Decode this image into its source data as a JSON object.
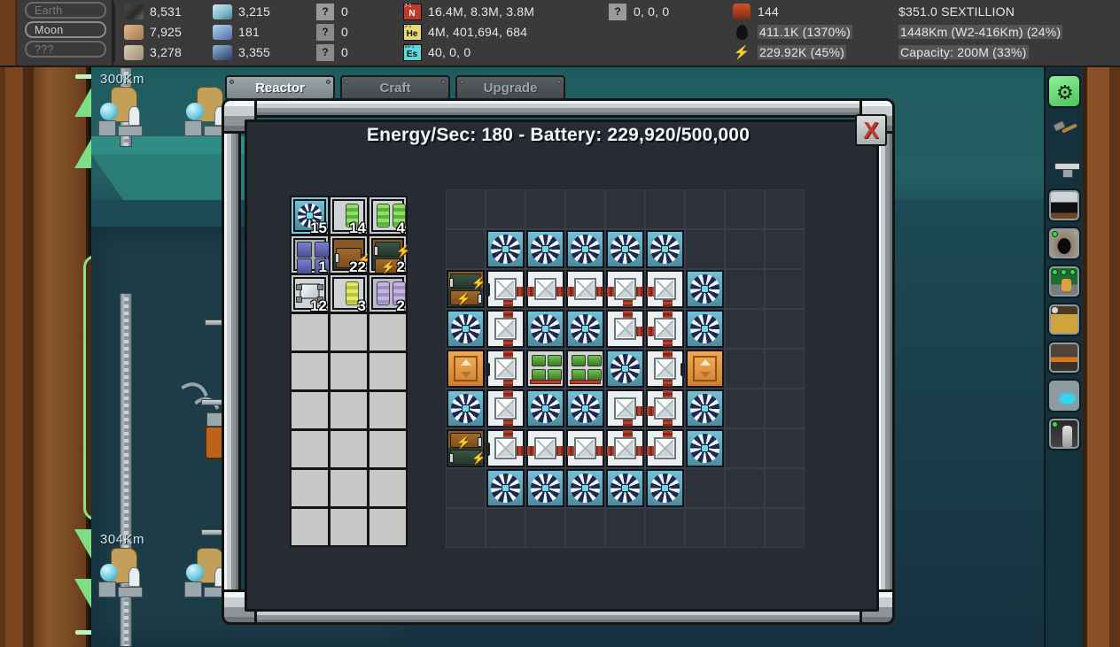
{
  "topbar": {
    "locations": [
      {
        "label": "Earth",
        "state": "dim"
      },
      {
        "label": "Moon",
        "state": "active"
      },
      {
        "label": "???",
        "state": "dim"
      }
    ],
    "ore_column": [
      {
        "icon": "rock-ore-icon",
        "value": "8,531"
      },
      {
        "icon": "sand-ore-icon",
        "value": "7,925"
      },
      {
        "icon": "tan-ore-icon",
        "value": "3,278"
      }
    ],
    "crystal_column": [
      {
        "icon": "crystal-icon",
        "value": "3,215"
      },
      {
        "icon": "ice-block-icon",
        "value": "181"
      },
      {
        "icon": "blue-shard-icon",
        "value": "3,355"
      }
    ],
    "unknown_column": [
      {
        "icon": "question-icon",
        "value": "0"
      },
      {
        "icon": "question-icon",
        "value": "0"
      },
      {
        "icon": "question-icon",
        "value": "0"
      }
    ],
    "element_column": [
      {
        "symbol": "N",
        "sup": "7-1",
        "value": "16.4M, 8.3M, 3.8M"
      },
      {
        "symbol": "He",
        "sup": "2-1",
        "value": "4M, 401,694, 684"
      },
      {
        "symbol": "Es",
        "sup": "99-1",
        "value": "40, 0, 0"
      }
    ],
    "unknown2_column": [
      {
        "icon": "question-icon",
        "value": "0, 0, 0"
      }
    ],
    "production_column": [
      {
        "icon": "miner-icon",
        "value": "144",
        "highlight": false
      },
      {
        "icon": "oil-icon",
        "value": "411.1K (1370%)",
        "highlight": true
      },
      {
        "icon": "power-icon",
        "value": "229.92K (45%)",
        "highlight": true
      }
    ],
    "money_column": [
      {
        "value": "$351.0 SEXTILLION",
        "highlight": false
      },
      {
        "value": "1448Km (W2-416Km) (24%)",
        "highlight": true
      },
      {
        "value": "Capacity: 200M (33%)",
        "highlight": true
      }
    ]
  },
  "world": {
    "depth_top_label": "300Km",
    "depth_bottom_label": "304Km"
  },
  "rail": {
    "items": [
      {
        "name": "settings-gear-icon",
        "label": "Settings"
      },
      {
        "name": "hammer-icon",
        "label": "Craft Hammer"
      },
      {
        "name": "anvil-icon",
        "label": "Anvil"
      },
      {
        "name": "factory-icon",
        "label": "Factory"
      },
      {
        "name": "cave-icon",
        "label": "Cave"
      },
      {
        "name": "market-icon",
        "label": "Market"
      },
      {
        "name": "quarry-icon",
        "label": "Quarry"
      },
      {
        "name": "lava-icon",
        "label": "Lava Mine"
      },
      {
        "name": "reactor-icon",
        "label": "Reactor"
      },
      {
        "name": "rocket-icon",
        "label": "Rocket"
      }
    ]
  },
  "dialog": {
    "tabs": [
      {
        "label": "Reactor",
        "active": true
      },
      {
        "label": "Craft",
        "active": false
      },
      {
        "label": "Upgrade",
        "active": false
      }
    ],
    "close_label": "X",
    "title": "Energy/Sec: 180 - Battery: 229,920/500,000",
    "stats": {
      "energy_per_sec": 180,
      "battery_current": "229,920",
      "battery_max": "500,000"
    },
    "palette": {
      "columns": 3,
      "rows": 9,
      "cells": [
        {
          "type": "fan",
          "count": "15",
          "selected": true
        },
        {
          "type": "fuel-green",
          "count": "14",
          "selected": false
        },
        {
          "type": "fuel-green-double",
          "count": "4",
          "selected": false
        },
        {
          "type": "battery-quad",
          "count": "1",
          "selected": false
        },
        {
          "type": "capacitor",
          "count": "22",
          "selected": false
        },
        {
          "type": "capacitor-double",
          "count": "2",
          "selected": false
        },
        {
          "type": "filter",
          "count": "12",
          "selected": false
        },
        {
          "type": "fuel-yellow",
          "count": "3",
          "selected": false
        },
        {
          "type": "coolant-double",
          "count": "2",
          "selected": false
        },
        {
          "type": "empty",
          "count": "",
          "selected": false
        },
        {
          "type": "empty",
          "count": "",
          "selected": false
        },
        {
          "type": "empty",
          "count": "",
          "selected": false
        },
        {
          "type": "empty",
          "count": "",
          "selected": false
        },
        {
          "type": "empty",
          "count": "",
          "selected": false
        },
        {
          "type": "empty",
          "count": "",
          "selected": false
        },
        {
          "type": "empty",
          "count": "",
          "selected": false
        },
        {
          "type": "empty",
          "count": "",
          "selected": false
        },
        {
          "type": "empty",
          "count": "",
          "selected": false
        },
        {
          "type": "empty",
          "count": "",
          "selected": false
        },
        {
          "type": "empty",
          "count": "",
          "selected": false
        },
        {
          "type": "empty",
          "count": "",
          "selected": false
        },
        {
          "type": "empty",
          "count": "",
          "selected": false
        },
        {
          "type": "empty",
          "count": "",
          "selected": false
        },
        {
          "type": "empty",
          "count": "",
          "selected": false
        },
        {
          "type": "empty",
          "count": "",
          "selected": false
        },
        {
          "type": "empty",
          "count": "",
          "selected": false
        },
        {
          "type": "empty",
          "count": "",
          "selected": false
        },
        {
          "type": "empty",
          "count": "",
          "selected": false
        }
      ]
    },
    "reactor_grid": {
      "columns": 9,
      "rows": 9,
      "cells": [
        "empty",
        "empty",
        "empty",
        "empty",
        "empty",
        "empty",
        "empty",
        "empty",
        "empty",
        "empty",
        "fan",
        "fan",
        "fan",
        "fan",
        "fan",
        "empty",
        "empty",
        "empty",
        "capacitor-double",
        "vent",
        "vent",
        "vent",
        "vent",
        "vent",
        "fan",
        "empty",
        "empty",
        "fan",
        "vent",
        "fan",
        "fan",
        "vent",
        "vent",
        "fan",
        "empty",
        "empty",
        "pump",
        "vent",
        "generator",
        "generator",
        "fan",
        "vent",
        "pump",
        "empty",
        "empty",
        "fan",
        "vent",
        "fan",
        "fan",
        "vent",
        "vent",
        "fan",
        "empty",
        "empty",
        "capacitor-double",
        "vent",
        "vent",
        "vent",
        "vent",
        "vent",
        "fan",
        "empty",
        "empty",
        "empty",
        "fan",
        "fan",
        "fan",
        "fan",
        "fan",
        "empty",
        "empty",
        "empty",
        "empty",
        "empty",
        "empty",
        "empty",
        "empty",
        "empty",
        "empty",
        "empty",
        "empty"
      ]
    }
  },
  "colors": {
    "accent_green": "#7ede82",
    "fan_blue": "#4b8ba0",
    "capacitor_brown": "#8b5a24",
    "pump_orange": "#cf7f2c",
    "coil_red": "#b2402c",
    "close_red": "#c0392b",
    "panel_bg": "#272c34"
  }
}
